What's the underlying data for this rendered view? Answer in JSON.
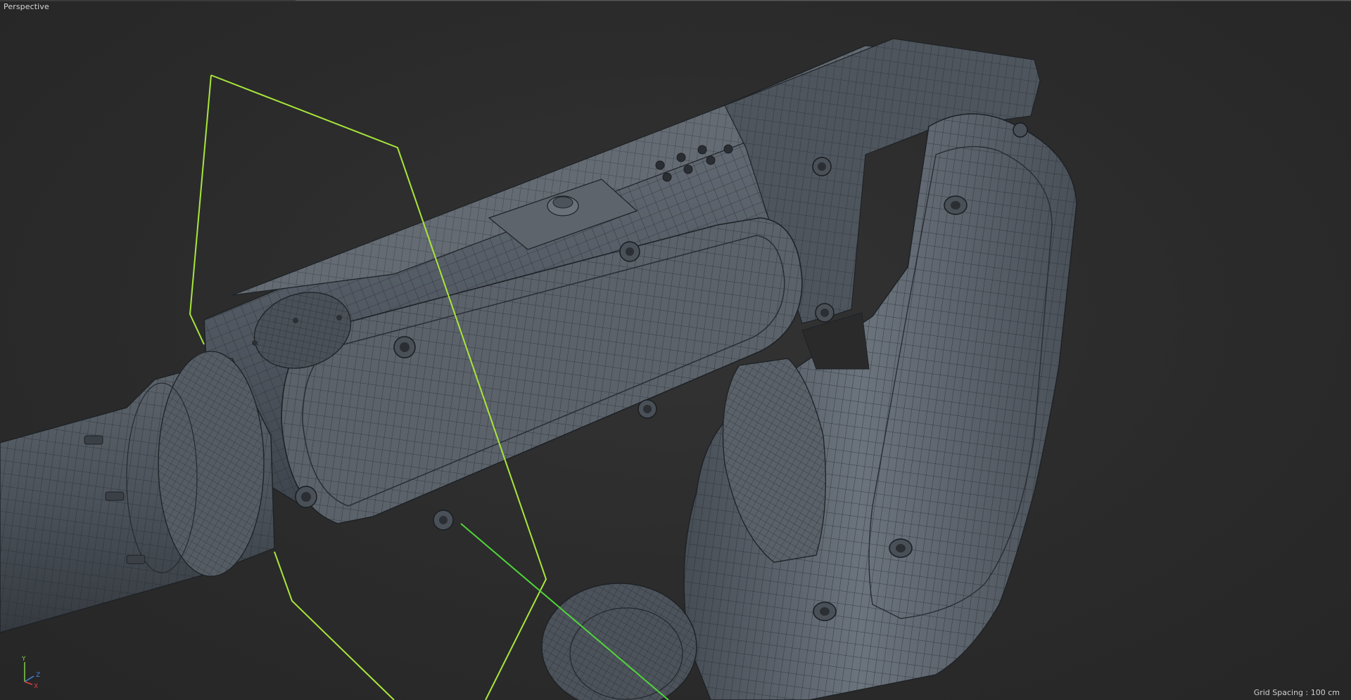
{
  "viewport": {
    "label": "Perspective",
    "grid_spacing": "Grid Spacing : 100 cm",
    "axes": {
      "y": "Y",
      "z": "Z",
      "x": "X"
    }
  },
  "colors": {
    "background": "#2b2b2b",
    "mesh_fill": "#545b64",
    "mesh_dark": "#3d434b",
    "wireframe": "#1f2328",
    "selection_outline": "#a8e63a",
    "axis_x": "#e04040",
    "axis_y": "#7fd14a",
    "axis_z": "#4a7fe0"
  },
  "scene": {
    "object": "robot-arm-wireframe-mesh"
  }
}
